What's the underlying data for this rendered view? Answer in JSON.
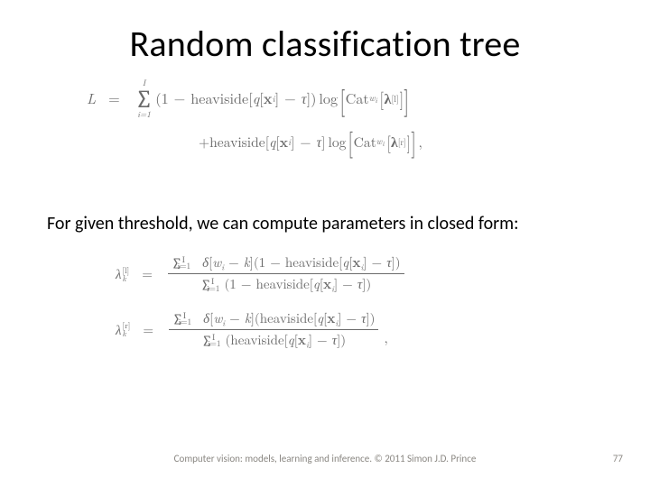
{
  "slide": {
    "title": "Random classification tree",
    "body_text": "For given threshold, we can compute parameters in closed form:",
    "footer_center": "Computer vision: models, learning and inference.  © 2011 Simon J.D. Prince",
    "footer_right": "77"
  },
  "eq1": {
    "lhs": "L",
    "eq": "=",
    "sum_lower": "i=1",
    "sum_upper": "I",
    "one": "1",
    "minus": "−",
    "heav": "heaviside",
    "q": "q",
    "x": "x",
    "tau": "τ",
    "log": "log",
    "cat": "Cat",
    "w": "w",
    "lam": "λ",
    "sup_l": "[l]",
    "i": "i"
  },
  "eq1b": {
    "plus": "+",
    "heav": "heaviside",
    "q": "q",
    "x": "x",
    "i": "i",
    "minus": "−",
    "tau": "τ",
    "log": "log",
    "cat": "Cat",
    "w": "w",
    "lam": "λ",
    "sup_r": "[r]",
    "comma": ","
  },
  "eq2": {
    "lam": "λ",
    "sup_l": "[l]",
    "k": "k",
    "eq": "=",
    "sum": "∑",
    "lim_lower": "i=1",
    "lim_upper": "I",
    "delta": "δ",
    "w": "w",
    "minus": "−",
    "one": "1",
    "heav": "heaviside",
    "q": "q",
    "x": "x",
    "tau": "τ",
    "i": "i"
  },
  "eq3": {
    "lam": "λ",
    "sup_r": "[r]",
    "k": "k",
    "eq": "=",
    "sum": "∑",
    "lim_lower": "i=1",
    "lim_upper": "I",
    "delta": "δ",
    "w": "w",
    "minus": "−",
    "heav": "heaviside",
    "q": "q",
    "x": "x",
    "tau": "τ",
    "i": "i",
    "comma": ","
  }
}
